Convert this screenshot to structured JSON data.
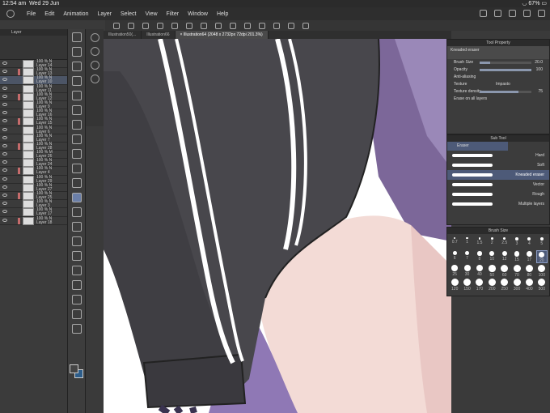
{
  "status": {
    "time": "12:54 am",
    "date": "Wed 29 Jun",
    "battery": "67%"
  },
  "menu": {
    "items": [
      "File",
      "Edit",
      "Animation",
      "Layer",
      "Select",
      "View",
      "Filter",
      "Window",
      "Help"
    ]
  },
  "tabs": [
    {
      "label": "Illustration50(..."
    },
    {
      "label": "Illustration66"
    },
    {
      "label": "× Illustration64 (2048 x 2732px 72dpi 201.3%)"
    }
  ],
  "layers": {
    "title": "Layer",
    "items": [
      {
        "pct": "100 %  N",
        "name": "Layer 14",
        "sel": false
      },
      {
        "pct": "100 %  N",
        "name": "Layer 13",
        "sel": false
      },
      {
        "pct": "100 %  N",
        "name": "Layer 10",
        "sel": true
      },
      {
        "pct": "100 %  N",
        "name": "Layer 11",
        "sel": false
      },
      {
        "pct": "100 %  N",
        "name": "Layer 12",
        "sel": false
      },
      {
        "pct": "100 %  N",
        "name": "Layer 9",
        "sel": false
      },
      {
        "pct": "100 %  N",
        "name": "Layer 16",
        "sel": false
      },
      {
        "pct": "100 %  N",
        "name": "Layer 15",
        "sel": false
      },
      {
        "pct": "100 %  N",
        "name": "Layer 6",
        "sel": false
      },
      {
        "pct": "100 %  N",
        "name": "Layer 7",
        "sel": false
      },
      {
        "pct": "100 %  N",
        "name": "Layer 28",
        "sel": false
      },
      {
        "pct": "100 %  M",
        "name": "Layer 26",
        "sel": false
      },
      {
        "pct": "100 %  N",
        "name": "Layer 24",
        "sel": false
      },
      {
        "pct": "100 %  N",
        "name": "Layer 4",
        "sel": false
      },
      {
        "pct": "100 %  N",
        "name": "Layer 29",
        "sel": false
      },
      {
        "pct": "100 %  N",
        "name": "Layer 27",
        "sel": false
      },
      {
        "pct": "100 %  N",
        "name": "Layer 25",
        "sel": false
      },
      {
        "pct": "100 %  N",
        "name": "Layer 3",
        "sel": false
      },
      {
        "pct": "100 %  N",
        "name": "Layer 17",
        "sel": false
      },
      {
        "pct": "100 %  N",
        "name": "Layer 18",
        "sel": false
      }
    ]
  },
  "tool_property": {
    "title": "Tool Property",
    "tool": "Kneaded eraser",
    "brush_size_label": "Brush Size",
    "brush_size": "20.0",
    "opacity_label": "Opacity",
    "opacity": "100",
    "opacity_fraction": 1.0,
    "brush_size_fraction": 0.2,
    "antialias_label": "Anti-aliasing",
    "texture_label": "Texture",
    "texture_value": "Impasto",
    "texture_density_label": "Texture density",
    "texture_density": "75",
    "texture_density_fraction": 0.75,
    "erase_all_label": "Erase on all layers"
  },
  "sub_tool": {
    "title": "Sub Tool",
    "group": "Eraser",
    "items": [
      {
        "label": "Hard",
        "sel": false
      },
      {
        "label": "Soft",
        "sel": false
      },
      {
        "label": "Kneaded eraser",
        "sel": true
      },
      {
        "label": "Vector",
        "sel": false
      },
      {
        "label": "Rough",
        "sel": false
      },
      {
        "label": "Multiple layers",
        "sel": false
      }
    ]
  },
  "brush_size": {
    "title": "Brush Size",
    "sizes": [
      "0.7",
      "1",
      "1.5",
      "2",
      "2.5",
      "3",
      "4",
      "5",
      "6",
      "7",
      "8",
      "10",
      "12",
      "15",
      "17",
      "20",
      "25",
      "30",
      "40",
      "50",
      "60",
      "70",
      "80",
      "100",
      "120",
      "150",
      "170",
      "200",
      "250",
      "300",
      "400",
      "500"
    ],
    "selected": "20"
  }
}
